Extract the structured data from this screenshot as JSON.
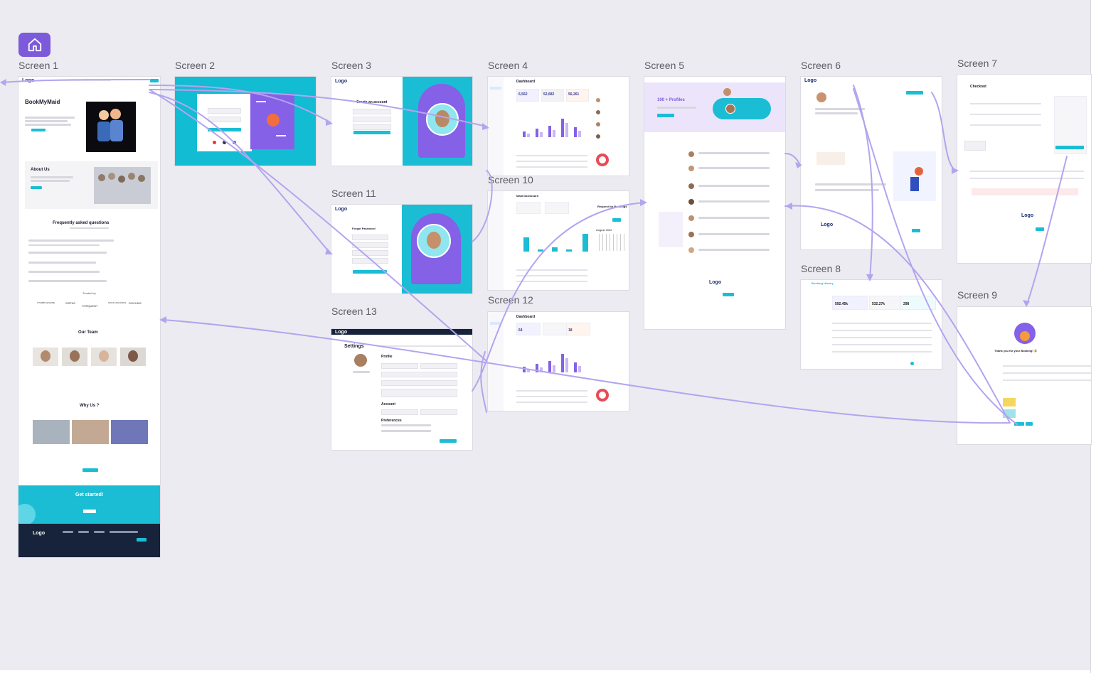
{
  "canvas": {
    "background": "#ecebf1",
    "link_color": "#b4a4ef",
    "accent": "#1bbdd4",
    "brand_purple": "#8461e6"
  },
  "toolbar": {
    "home_icon": "home-icon"
  },
  "screens": [
    {
      "id": "s1",
      "label": "Screen 1"
    },
    {
      "id": "s2",
      "label": "Screen 2"
    },
    {
      "id": "s3",
      "label": "Screen 3"
    },
    {
      "id": "s4",
      "label": "Screen 4"
    },
    {
      "id": "s5",
      "label": "Screen 5"
    },
    {
      "id": "s6",
      "label": "Screen 6"
    },
    {
      "id": "s7",
      "label": "Screen 7"
    },
    {
      "id": "s8",
      "label": "Screen 8"
    },
    {
      "id": "s9",
      "label": "Screen 9"
    },
    {
      "id": "s10",
      "label": "Screen 10"
    },
    {
      "id": "s11",
      "label": "Screen 11"
    },
    {
      "id": "s12",
      "label": "Screen 12"
    },
    {
      "id": "s13",
      "label": "Screen 13"
    }
  ],
  "s1": {
    "logo": "Logo",
    "hero_title": "BookMyMaid",
    "about_title": "About Us",
    "faq_title": "Frequently asked questions",
    "trusted_by": "Trusted by",
    "partners": [
      "UTURBO ENGINE",
      "SISTAS",
      "TORQUENT",
      "SOLIS HOLDINGS",
      "DOCUMS"
    ],
    "team_title": "Our Team",
    "why_title": "Why Us ?",
    "get_started": "Get started!",
    "footer_logo": "Logo"
  },
  "s3": {
    "logo": "Logo",
    "title": "Create an account"
  },
  "s4": {
    "title": "Dashboard",
    "stats": [
      "6,562",
      "52,682",
      "56,261"
    ]
  },
  "s5": {
    "hero_title": "100 + Profiles",
    "footer_logo": "Logo"
  },
  "s6": {
    "logo": "Logo",
    "footer_logo": "Logo"
  },
  "s7": {
    "title": "Checkout",
    "logo": "Logo"
  },
  "s8": {
    "title": "Booking History",
    "stats": [
      "592.45k",
      "532.27k",
      "298"
    ]
  },
  "s9": {
    "thanks": "Thank you for your Booking! 🎉"
  },
  "s10": {
    "title": "Maid Dashboard",
    "panel_title": "Request for Bookings",
    "calendar_title": "August 2022"
  },
  "s11": {
    "logo": "Logo",
    "title": "Forgot Password"
  },
  "s12": {
    "title": "Dashboard",
    "stats": [
      "64",
      "18"
    ]
  },
  "s13": {
    "logo": "Logo",
    "title": "Settings",
    "profile": "Profile",
    "account": "Account",
    "preferences": "Preferences"
  }
}
